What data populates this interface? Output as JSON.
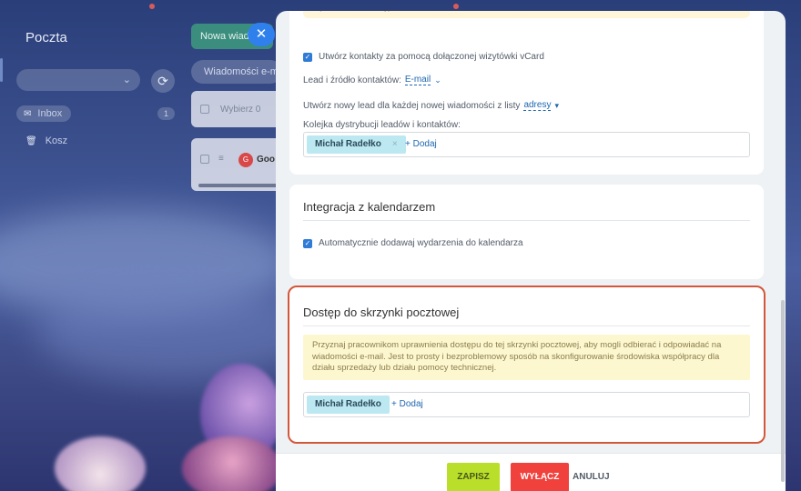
{
  "colors": {
    "accent_blue": "#2f80ed",
    "save_green": "#b9df2b",
    "disable_red": "#f0413d",
    "highlight_border": "#d4573b",
    "chip_bg": "#bce8f1",
    "notice_bg": "#fdf7d0"
  },
  "app": {
    "title": "Poczta",
    "refresh_icon": "refresh-icon",
    "folders": [
      {
        "label": "Inbox",
        "count": "1",
        "icon": "inbox-icon"
      },
      {
        "label": "Kosz",
        "icon": "trash-icon"
      }
    ]
  },
  "list": {
    "new_message_label": "Nowa wiad",
    "search_placeholder": "Wiadomości e-ma",
    "select_placeholder": "Wybierz 0",
    "sender_initial": "G",
    "sender_partial": "Goo"
  },
  "panel": {
    "close_icon": "close-icon",
    "top_notice": "uprawnień dostępu.",
    "card1": {
      "create_contacts_label": "Utwórz kontakty za pomocą dołączonej wizytówki vCard",
      "lead_source_label": "Lead i źródło kontaktów:",
      "lead_source_value": "E-mail",
      "new_lead_label": "Utwórz nowy lead dla każdej nowej wiadomości z listy",
      "new_lead_value": "adresy",
      "queue_label": "Kolejka dystrybucji leadów i kontaktów:",
      "queue_chip": "Michał Radełko",
      "add_label": "+ Dodaj"
    },
    "card2": {
      "title": "Integracja z kalendarzem",
      "auto_add_label": "Automatycznie dodawaj wydarzenia do kalendarza"
    },
    "card3": {
      "title": "Dostęp do skrzynki pocztowej",
      "info": "Przyznaj pracownikom uprawnienia dostępu do tej skrzynki pocztowej, aby mogli odbierać i odpowiadać na wiadomości e-mail. Jest to prosty i bezproblemowy sposób na skonfigurowanie środowiska współpracy dla działu sprzedaży lub działu pomocy technicznej.",
      "chip": "Michał Radełko",
      "add_label": "+ Dodaj"
    },
    "footer": {
      "save": "ZAPISZ",
      "disable": "WYŁĄCZ",
      "cancel": "ANULUJ"
    }
  }
}
